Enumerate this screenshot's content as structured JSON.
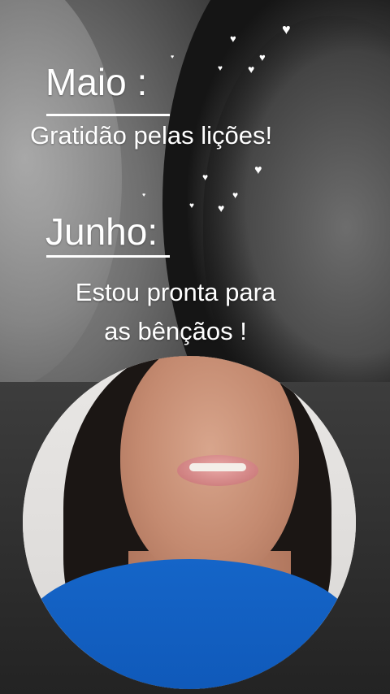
{
  "story": {
    "month1": "Maio :",
    "message1": "Gratidão pelas lições!",
    "month2": "Junho:",
    "message2_line1": "Estou pronta para",
    "message2_line2": "as bênçãos !"
  },
  "decorations": {
    "heart_icon": "heart-icon",
    "color": "#ffffff"
  },
  "colors": {
    "text": "#ffffff",
    "shirt": "#1565c8"
  }
}
